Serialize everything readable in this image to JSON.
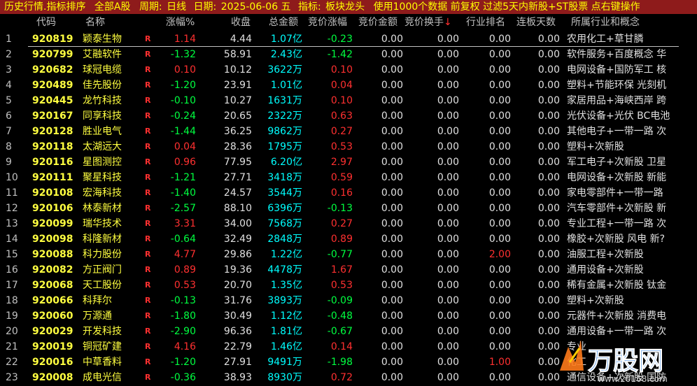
{
  "title": {
    "segments": [
      {
        "text": "历史行情.指标排序"
      },
      {
        "text": "全部A股"
      },
      {
        "text": "周期:"
      },
      {
        "text": "日线"
      },
      {
        "text": "日期:"
      },
      {
        "text": "2025-06-06 五"
      },
      {
        "text": "指标:"
      },
      {
        "text": "板块龙头"
      },
      {
        "text": "使用1000个数据 前复权 过滤5天内新股+ST股票 点右键操作"
      }
    ]
  },
  "columns": {
    "code": "代码",
    "name": "名称",
    "pct": "涨幅%",
    "close": "收盘",
    "amount": "总金额",
    "bid_pct": "竞价涨幅",
    "bid_amount": "竞价金额",
    "bid_turnover": "竞价换手",
    "rank": "行业排名",
    "days": "连板天数",
    "industry": "所属行业和概念"
  },
  "rows": [
    {
      "idx": "1",
      "code": "920819",
      "name": "颖泰生物",
      "flag": "R",
      "pct": "1.14",
      "close": "4.44",
      "amt": "1.07",
      "unit": "亿",
      "bid": "-0.23",
      "bidamt": "0.00",
      "turn": "0.00",
      "rank": "0.00",
      "days": "0.00",
      "ind": "农用化工+草甘膦"
    },
    {
      "idx": "2",
      "code": "920799",
      "name": "艾融软件",
      "flag": "R",
      "pct": "-1.32",
      "close": "58.91",
      "amt": "2.43",
      "unit": "亿",
      "bid": "-1.42",
      "bidamt": "0.00",
      "turn": "0.00",
      "rank": "0.00",
      "days": "0.00",
      "ind": "软件服务+百度概念 华"
    },
    {
      "idx": "3",
      "code": "920682",
      "name": "球冠电缆",
      "flag": "R",
      "pct": "0.10",
      "close": "10.12",
      "amt": "3622",
      "unit": "万",
      "bid": "0.10",
      "bidamt": "0.00",
      "turn": "0.00",
      "rank": "0.00",
      "days": "0.00",
      "ind": "电网设备+国防军工 核"
    },
    {
      "idx": "4",
      "code": "920489",
      "name": "佳先股份",
      "flag": "R",
      "pct": "-1.20",
      "close": "23.91",
      "amt": "1.01",
      "unit": "亿",
      "bid": "0.04",
      "bidamt": "0.00",
      "turn": "0.00",
      "rank": "0.00",
      "days": "0.00",
      "ind": "塑料+节能环保 光刻机"
    },
    {
      "idx": "5",
      "code": "920445",
      "name": "龙竹科技",
      "flag": "R",
      "pct": "-0.10",
      "close": "10.27",
      "amt": "1631",
      "unit": "万",
      "bid": "0.10",
      "bidamt": "0.00",
      "turn": "0.00",
      "rank": "0.00",
      "days": "0.00",
      "ind": "家居用品+海峡西岸 跨"
    },
    {
      "idx": "6",
      "code": "920167",
      "name": "同享科技",
      "flag": "R",
      "pct": "-0.24",
      "close": "20.65",
      "amt": "2322",
      "unit": "万",
      "bid": "0.63",
      "bidamt": "0.00",
      "turn": "0.00",
      "rank": "0.00",
      "days": "0.00",
      "ind": "光伏设备+光伏 BC电池"
    },
    {
      "idx": "7",
      "code": "920128",
      "name": "胜业电气",
      "flag": "R",
      "pct": "-1.44",
      "close": "36.25",
      "amt": "9862",
      "unit": "万",
      "bid": "0.27",
      "bidamt": "0.00",
      "turn": "0.00",
      "rank": "0.00",
      "days": "0.00",
      "ind": "其他电子+一带一路 次"
    },
    {
      "idx": "8",
      "code": "920118",
      "name": "太湖远大",
      "flag": "R",
      "pct": "0.04",
      "close": "28.36",
      "amt": "1795",
      "unit": "万",
      "bid": "0.53",
      "bidamt": "0.00",
      "turn": "0.00",
      "rank": "0.00",
      "days": "0.00",
      "ind": "塑料+次新股"
    },
    {
      "idx": "9",
      "code": "920116",
      "name": "星图测控",
      "flag": "R",
      "pct": "0.96",
      "close": "77.95",
      "amt": "6.20",
      "unit": "亿",
      "bid": "2.97",
      "bidamt": "0.00",
      "turn": "0.00",
      "rank": "0.00",
      "days": "0.00",
      "ind": "军工电子+次新股 卫星"
    },
    {
      "idx": "10",
      "code": "920111",
      "name": "聚星科技",
      "flag": "R",
      "pct": "-1.21",
      "close": "27.71",
      "amt": "3418",
      "unit": "万",
      "bid": "0.59",
      "bidamt": "0.00",
      "turn": "0.00",
      "rank": "0.00",
      "days": "0.00",
      "ind": "电网设备+次新股 新能"
    },
    {
      "idx": "11",
      "code": "920108",
      "name": "宏海科技",
      "flag": "R",
      "pct": "-1.40",
      "close": "24.57",
      "amt": "3544",
      "unit": "万",
      "bid": "0.16",
      "bidamt": "0.00",
      "turn": "0.00",
      "rank": "0.00",
      "days": "0.00",
      "ind": "家电零部件+一带一路"
    },
    {
      "idx": "12",
      "code": "920106",
      "name": "林泰新材",
      "flag": "R",
      "pct": "-2.57",
      "close": "88.10",
      "amt": "6396",
      "unit": "万",
      "bid": "-0.13",
      "bidamt": "0.00",
      "turn": "0.00",
      "rank": "0.00",
      "days": "0.00",
      "ind": "汽车零部件+次新股 新"
    },
    {
      "idx": "13",
      "code": "920099",
      "name": "瑞华技术",
      "flag": "R",
      "pct": "3.31",
      "close": "34.00",
      "amt": "7568",
      "unit": "万",
      "bid": "0.27",
      "bidamt": "0.00",
      "turn": "0.00",
      "rank": "0.00",
      "days": "0.00",
      "ind": "专业工程+一带一路 次"
    },
    {
      "idx": "14",
      "code": "920098",
      "name": "科隆新材",
      "flag": "R",
      "pct": "-0.64",
      "close": "32.49",
      "amt": "2848",
      "unit": "万",
      "bid": "0.89",
      "bidamt": "0.00",
      "turn": "0.00",
      "rank": "0.00",
      "days": "0.00",
      "ind": "橡胶+次新股 风电 新?"
    },
    {
      "idx": "15",
      "code": "920088",
      "name": "科力股份",
      "flag": "R",
      "pct": "4.77",
      "close": "29.86",
      "amt": "1.22",
      "unit": "亿",
      "bid": "-0.77",
      "bidamt": "0.00",
      "turn": "0.00",
      "rank": "2.00",
      "days": "0.00",
      "ind": "油服工程+次新股"
    },
    {
      "idx": "16",
      "code": "920082",
      "name": "方正阀门",
      "flag": "R",
      "pct": "0.89",
      "close": "19.36",
      "amt": "4478",
      "unit": "万",
      "bid": "1.67",
      "bidamt": "0.00",
      "turn": "0.00",
      "rank": "0.00",
      "days": "0.00",
      "ind": "通用设备+次新股"
    },
    {
      "idx": "17",
      "code": "920068",
      "name": "天工股份",
      "flag": "R",
      "pct": "0.53",
      "close": "20.70",
      "amt": "1.35",
      "unit": "亿",
      "bid": "0.53",
      "bidamt": "0.00",
      "turn": "0.00",
      "rank": "0.00",
      "days": "0.00",
      "ind": "稀有金属+次新股 钛金"
    },
    {
      "idx": "18",
      "code": "920066",
      "name": "科拜尔",
      "flag": "R",
      "pct": "-0.13",
      "close": "31.76",
      "amt": "3893",
      "unit": "万",
      "bid": "-0.09",
      "bidamt": "0.00",
      "turn": "0.00",
      "rank": "0.00",
      "days": "0.00",
      "ind": "塑料+次新股"
    },
    {
      "idx": "19",
      "code": "920060",
      "name": "万源通",
      "flag": "R",
      "pct": "-1.80",
      "close": "30.49",
      "amt": "1.12",
      "unit": "亿",
      "bid": "-0.48",
      "bidamt": "0.00",
      "turn": "0.00",
      "rank": "0.00",
      "days": "0.00",
      "ind": "元器件+次新股 消费电"
    },
    {
      "idx": "20",
      "code": "920029",
      "name": "开发科技",
      "flag": "R",
      "pct": "-2.90",
      "close": "96.36",
      "amt": "1.81",
      "unit": "亿",
      "bid": "-0.67",
      "bidamt": "0.00",
      "turn": "0.00",
      "rank": "0.00",
      "days": "0.00",
      "ind": "通用设备+一带一路 次"
    },
    {
      "idx": "21",
      "code": "920019",
      "name": "铜冠矿建",
      "flag": "R",
      "pct": "4.16",
      "close": "22.79",
      "amt": "1.46",
      "unit": "亿",
      "bid": "0.14",
      "bidamt": "0.00",
      "turn": "0.00",
      "rank": "0.00",
      "days": "0.00",
      "ind": "专业"
    },
    {
      "idx": "22",
      "code": "920016",
      "name": "中草香料",
      "flag": "R",
      "pct": "-1.20",
      "close": "27.91",
      "amt": "9491",
      "unit": "万",
      "bid": "-1.98",
      "bidamt": "0.00",
      "turn": "0.00",
      "rank": "1.00",
      "days": "0.00",
      "ind": "化工"
    },
    {
      "idx": "23",
      "code": "920008",
      "name": "成电光信",
      "flag": "R",
      "pct": "-0.36",
      "close": "38.93",
      "amt": "8930",
      "unit": "万",
      "bid": "0.72",
      "bidamt": "0.00",
      "turn": "0.00",
      "rank": "0.00",
      "days": "0.00",
      "ind": "通信设备+次新股 国防"
    }
  ],
  "colors": {
    "up": "#ff3030",
    "down": "#00ff40",
    "code": "#ffff40",
    "amount": "#00ffff",
    "titlebar": "#8e1b1b"
  },
  "watermark": {
    "text": "万股网",
    "sub": "www.20168.com"
  }
}
